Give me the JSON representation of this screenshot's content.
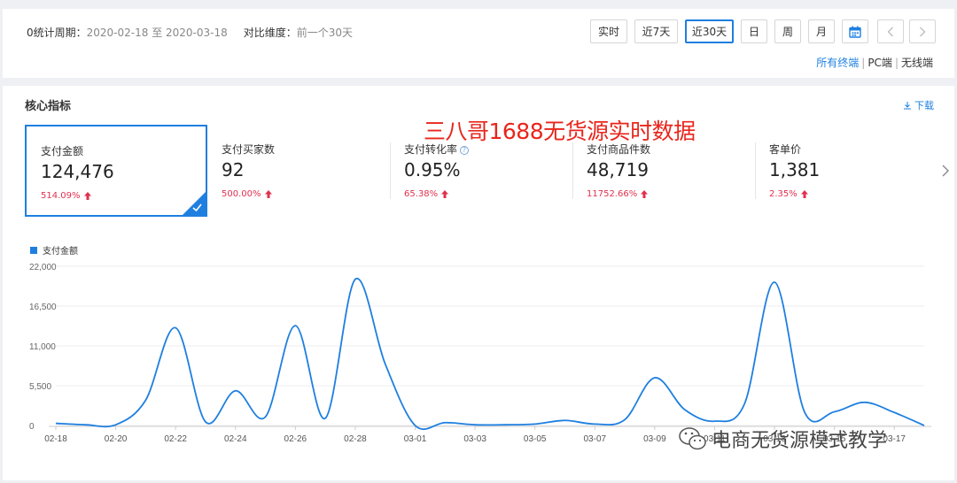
{
  "top": {
    "period_label": "0统计周期：",
    "period_value": "2020-02-18 至 2020-03-18",
    "compare_label": "对比维度：",
    "compare_value": "前一个30天",
    "time_buttons": [
      {
        "label": "实时",
        "active": false
      },
      {
        "label": "近7天",
        "active": false
      },
      {
        "label": "近30天",
        "active": true
      },
      {
        "label": "日",
        "active": false
      },
      {
        "label": "周",
        "active": false
      },
      {
        "label": "月",
        "active": false
      }
    ],
    "calendar_icon": "calendar-icon",
    "prev_icon": "chevron-left-icon",
    "next_icon": "chevron-right-icon",
    "terminals": {
      "all": "所有终端",
      "pc": "PC端",
      "wireless": "无线端",
      "separator": "|"
    }
  },
  "main": {
    "title": "核心指标",
    "download": "下载",
    "overlay_text": "三八哥1688无货源实时数据",
    "metrics": [
      {
        "name": "支付金额",
        "value": "124,476",
        "change": "514.09%",
        "selected": true
      },
      {
        "name": "支付买家数",
        "value": "92",
        "change": "500.00%",
        "selected": false
      },
      {
        "name": "支付转化率",
        "value": "0.95%",
        "change": "65.38%",
        "selected": false,
        "info": "?"
      },
      {
        "name": "支付商品件数",
        "value": "48,719",
        "change": "11752.66%",
        "selected": false
      },
      {
        "name": "客单价",
        "value": "1,381",
        "change": "2.35%",
        "selected": false
      }
    ],
    "watermark_text": "电商无货源模式教学"
  },
  "colors": {
    "accent": "#1e7fe0",
    "up": "#e0304e",
    "overlay": "#e8261c"
  },
  "chart_data": {
    "type": "line",
    "series": [
      {
        "name": "支付金额",
        "x": [
          "02-18",
          "02-19",
          "02-20",
          "02-21",
          "02-22",
          "02-23",
          "02-24",
          "02-25",
          "02-26",
          "02-27",
          "02-28",
          "02-29",
          "03-01",
          "03-02",
          "03-03",
          "03-04",
          "03-05",
          "03-06",
          "03-07",
          "03-08",
          "03-09",
          "03-10",
          "03-11",
          "03-12",
          "03-13",
          "03-14",
          "03-15",
          "03-16",
          "03-17",
          "03-18"
        ],
        "values": [
          300,
          100,
          100,
          3500,
          13500,
          500,
          4800,
          1200,
          13800,
          1000,
          20200,
          8500,
          0,
          400,
          100,
          100,
          200,
          700,
          200,
          800,
          6600,
          2200,
          600,
          3000,
          19800,
          1900,
          1900,
          3200,
          1800,
          0
        ]
      }
    ],
    "x_tick_labels": [
      "02-18",
      "02-20",
      "02-22",
      "02-24",
      "02-26",
      "02-28",
      "03-01",
      "03-03",
      "03-05",
      "03-07",
      "03-09",
      "03-11",
      "03-13",
      "03-15",
      "03-17"
    ],
    "y_ticks": [
      "0",
      "5,500",
      "11,000",
      "16,500",
      "22,000"
    ],
    "ylim": [
      0,
      22000
    ],
    "grid": true,
    "legend": "top-left"
  }
}
